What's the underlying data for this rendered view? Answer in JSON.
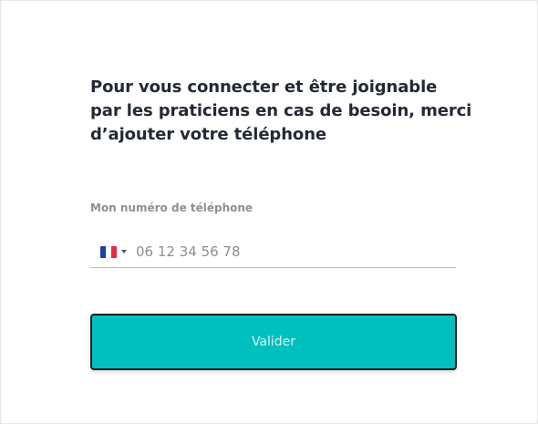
{
  "heading": "Pour vous connecter et être joignable par les praticiens en cas de besoin, merci d’ajouter votre téléphone",
  "phone": {
    "label": "Mon numéro de téléphone",
    "country_flag": "france-flag-icon",
    "placeholder": "06 12 34 56 78",
    "value": ""
  },
  "submit": {
    "label": "Valider",
    "color": "#00bfbf"
  }
}
